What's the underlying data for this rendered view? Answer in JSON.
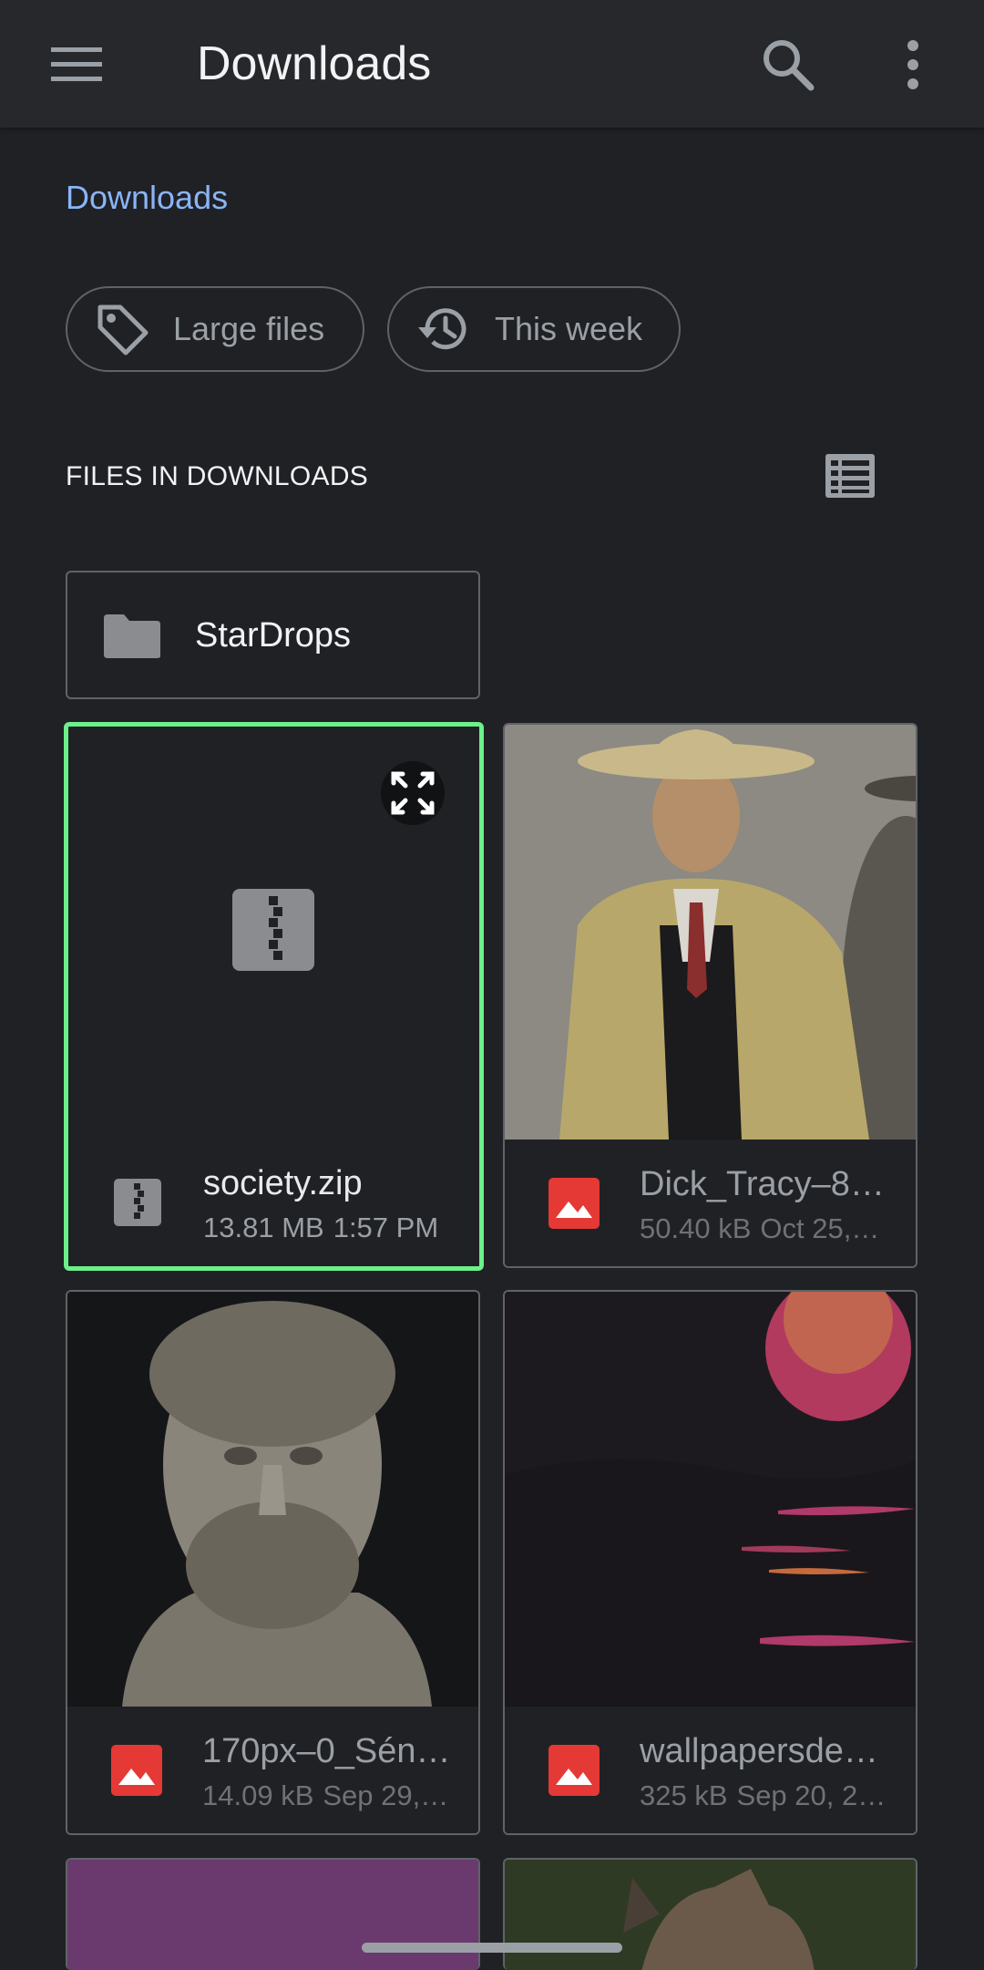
{
  "app_bar": {
    "title": "Downloads",
    "menu_icon": "hamburger-menu-icon",
    "search_icon": "search-icon",
    "more_icon": "more-vert-icon"
  },
  "breadcrumb": "Downloads",
  "chips": [
    {
      "label": "Large files",
      "icon": "label-tag-icon"
    },
    {
      "label": "This week",
      "icon": "history-icon"
    }
  ],
  "section": {
    "title": "FILES IN DOWNLOADS",
    "view_toggle_icon": "list-view-icon"
  },
  "folder": {
    "name": "StarDrops",
    "icon": "folder-icon"
  },
  "files": [
    {
      "name": "society.zip",
      "size": "13.81 MB",
      "date": "1:57 PM",
      "type_icon": "zip-icon",
      "selected": true
    },
    {
      "name": "Dick_Tracy–8…",
      "size": "50.40 kB",
      "date": "Oct 25,…",
      "type_icon": "image-icon",
      "selected": false
    },
    {
      "name": "170px–0_Sén…",
      "size": "14.09 kB",
      "date": "Sep 29,…",
      "type_icon": "image-icon",
      "selected": false
    },
    {
      "name": "wallpapersde…",
      "size": "325 kB",
      "date": "Sep 20, 2…",
      "type_icon": "image-icon",
      "selected": false
    }
  ],
  "colors": {
    "background": "#202124",
    "app_bar": "#26282b",
    "accent_link": "#8ab4f8",
    "selection_border": "#6cf08b",
    "image_icon": "#e53935"
  }
}
